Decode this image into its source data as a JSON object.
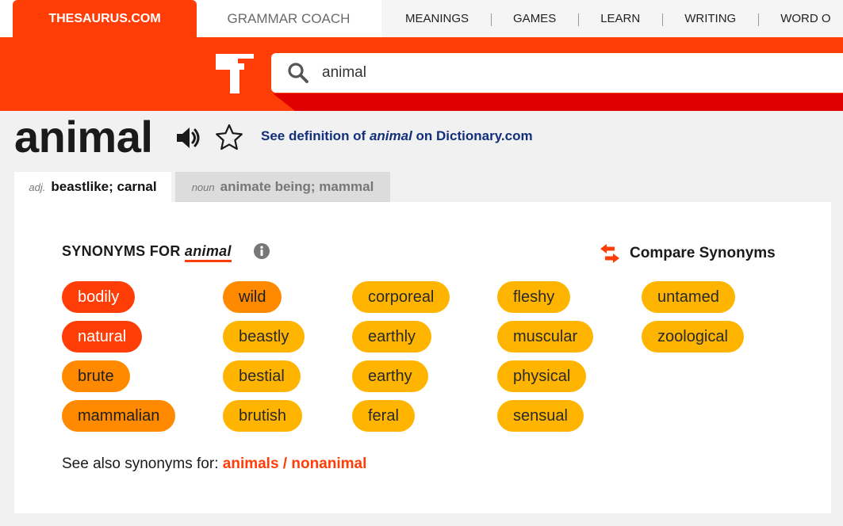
{
  "nav": {
    "brand": "THESAURUS.COM",
    "grammar_coach": "GRAMMAR COACH",
    "links": [
      "MEANINGS",
      "GAMES",
      "LEARN",
      "WRITING",
      "WORD O"
    ]
  },
  "search": {
    "value": "animal"
  },
  "entry": {
    "word": "animal",
    "def_link_prefix": "See definition of ",
    "def_link_word": "animal",
    "def_link_suffix": " on Dictionary.com"
  },
  "tabs": [
    {
      "pos": "adj.",
      "sense": "beastlike; carnal",
      "active": true
    },
    {
      "pos": "noun",
      "sense": "animate being; mammal",
      "active": false
    }
  ],
  "synonyms": {
    "heading": "SYNONYMS FOR ",
    "headword": "animal",
    "compare_label": "Compare Synonyms",
    "columns": [
      [
        {
          "word": "bodily",
          "level": 1
        },
        {
          "word": "natural",
          "level": 1
        },
        {
          "word": "brute",
          "level": 2
        },
        {
          "word": "mammalian",
          "level": 2
        }
      ],
      [
        {
          "word": "wild",
          "level": 2
        },
        {
          "word": "beastly",
          "level": 3
        },
        {
          "word": "bestial",
          "level": 3
        },
        {
          "word": "brutish",
          "level": 3
        }
      ],
      [
        {
          "word": "corporeal",
          "level": 3
        },
        {
          "word": "earthly",
          "level": 3
        },
        {
          "word": "earthy",
          "level": 3
        },
        {
          "word": "feral",
          "level": 3
        }
      ],
      [
        {
          "word": "fleshy",
          "level": 3
        },
        {
          "word": "muscular",
          "level": 3
        },
        {
          "word": "physical",
          "level": 3
        },
        {
          "word": "sensual",
          "level": 3
        }
      ],
      [
        {
          "word": "untamed",
          "level": 3
        },
        {
          "word": "zoological",
          "level": 3
        }
      ]
    ],
    "see_also_prefix": "See also synonyms for: ",
    "see_also_links": [
      "animals",
      "nonanimal"
    ],
    "see_also_sep": " / "
  },
  "colors": {
    "brand": "#ff3d06",
    "header_red": "#e00000",
    "relevance_high": "#ff3d06",
    "relevance_mid": "#ff8a00",
    "relevance_low": "#ffb400",
    "link_blue": "#12307a"
  }
}
